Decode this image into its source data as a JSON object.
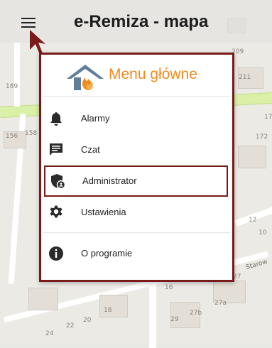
{
  "app": {
    "title": "e-Remiza - mapa"
  },
  "menu": {
    "title": "Menu główne",
    "items": [
      {
        "label": "Alarmy",
        "icon": "bell-icon"
      },
      {
        "label": "Czat",
        "icon": "chat-icon"
      },
      {
        "label": "Administrator",
        "icon": "admin-shield-icon",
        "selected": true
      },
      {
        "label": "Ustawienia",
        "icon": "gear-icon"
      },
      {
        "label": "O programie",
        "icon": "info-icon"
      }
    ]
  },
  "map": {
    "labels": [
      "209",
      "211",
      "189",
      "17",
      "156",
      "158",
      "172",
      "12",
      "10",
      "16",
      "27",
      "27a",
      "18",
      "20",
      "22",
      "24",
      "29",
      "27b"
    ],
    "street": "Starow"
  },
  "colors": {
    "accent": "#f08a1e",
    "highlight": "#7a1a1a"
  }
}
